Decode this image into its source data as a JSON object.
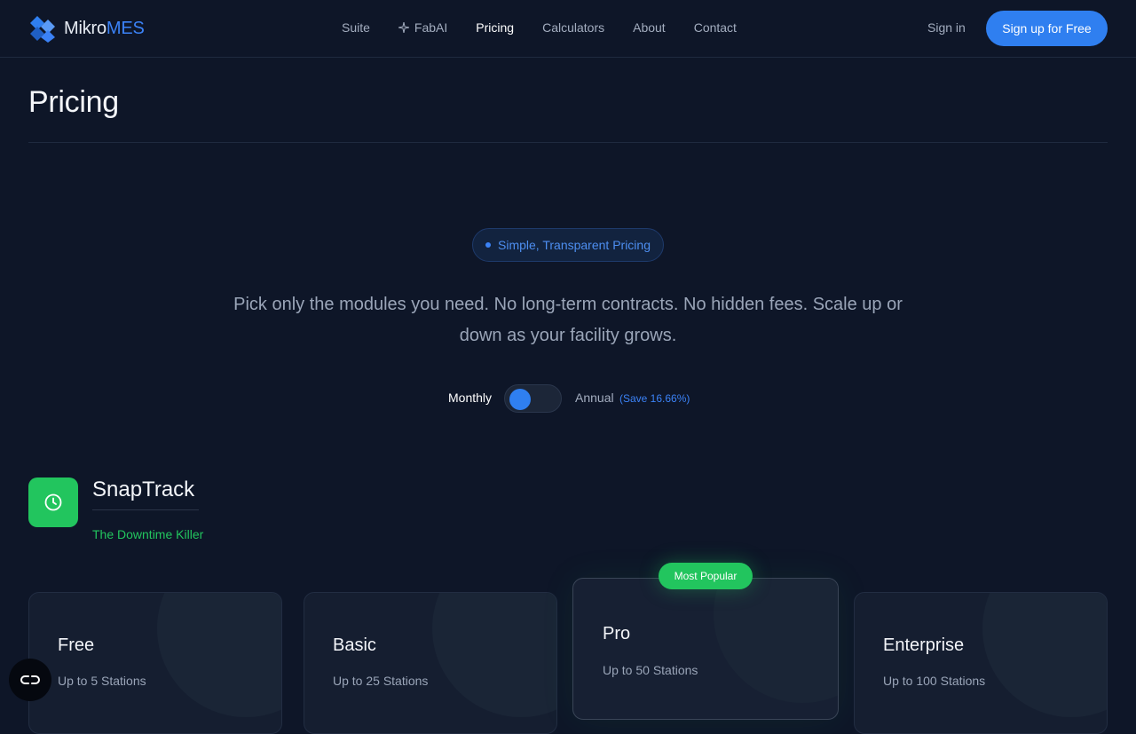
{
  "header": {
    "logo_part1": "Mikro",
    "logo_part2": "MES",
    "nav": [
      {
        "label": "Suite"
      },
      {
        "label": "FabAI"
      },
      {
        "label": "Pricing"
      },
      {
        "label": "Calculators"
      },
      {
        "label": "About"
      },
      {
        "label": "Contact"
      }
    ],
    "active_nav": "Pricing",
    "signin_label": "Sign in",
    "signup_label": "Sign up for Free"
  },
  "page": {
    "title": "Pricing",
    "pill": "Simple, Transparent Pricing",
    "lead": "Pick only the modules you need. No long-term contracts. No hidden fees. Scale up or down as your facility grows."
  },
  "billing": {
    "monthly_label": "Monthly",
    "annual_label": "Annual",
    "save_label": "(Save 16.66%)",
    "selected": "Monthly"
  },
  "product": {
    "name": "SnapTrack",
    "tagline": "The Downtime Killer",
    "icon": "clock-icon"
  },
  "plans": [
    {
      "name": "Free",
      "stations": "Up to 5 Stations"
    },
    {
      "name": "Basic",
      "stations": "Up to 25 Stations"
    },
    {
      "name": "Pro",
      "stations": "Up to 50 Stations",
      "badge": "Most Popular"
    },
    {
      "name": "Enterprise",
      "stations": "Up to 100 Stations"
    }
  ],
  "colors": {
    "accent": "#2f7ff0",
    "success": "#22c55e",
    "background": "#0e1628"
  }
}
